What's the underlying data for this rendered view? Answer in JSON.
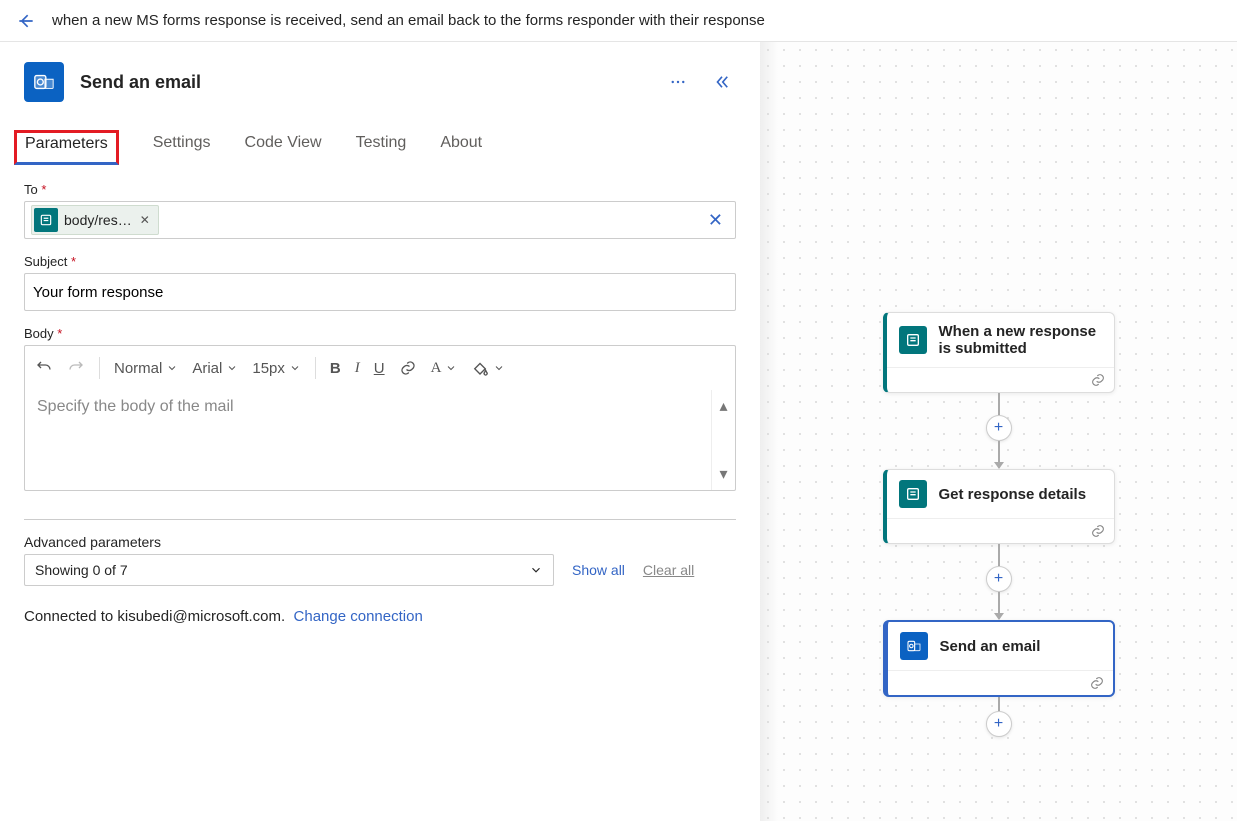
{
  "header": {
    "flow_name": "when a new MS forms response is received, send an email back to the forms responder with their response"
  },
  "panel": {
    "title": "Send an email",
    "tabs": [
      "Parameters",
      "Settings",
      "Code View",
      "Testing",
      "About"
    ],
    "active_tab": "Parameters",
    "fields": {
      "to_label": "To",
      "to_token": "body/res…",
      "subject_label": "Subject",
      "subject_value": "Your form response",
      "body_label": "Body",
      "body_placeholder": "Specify the body of the mail"
    },
    "toolbar": {
      "font_style": "Normal",
      "font_family": "Arial",
      "font_size": "15px"
    },
    "advanced": {
      "label": "Advanced parameters",
      "select_value": "Showing 0 of 7",
      "show_all": "Show all",
      "clear_all": "Clear all"
    },
    "connection": {
      "prefix": "Connected to ",
      "account": "kisubedi@microsoft.com.",
      "change_label": "Change connection"
    }
  },
  "canvas": {
    "cards": [
      {
        "id": "trigger",
        "title": "When a new response is submitted",
        "service": "forms"
      },
      {
        "id": "get_details",
        "title": "Get response details",
        "service": "forms"
      },
      {
        "id": "send_email",
        "title": "Send an email",
        "service": "outlook",
        "selected": true
      }
    ]
  }
}
